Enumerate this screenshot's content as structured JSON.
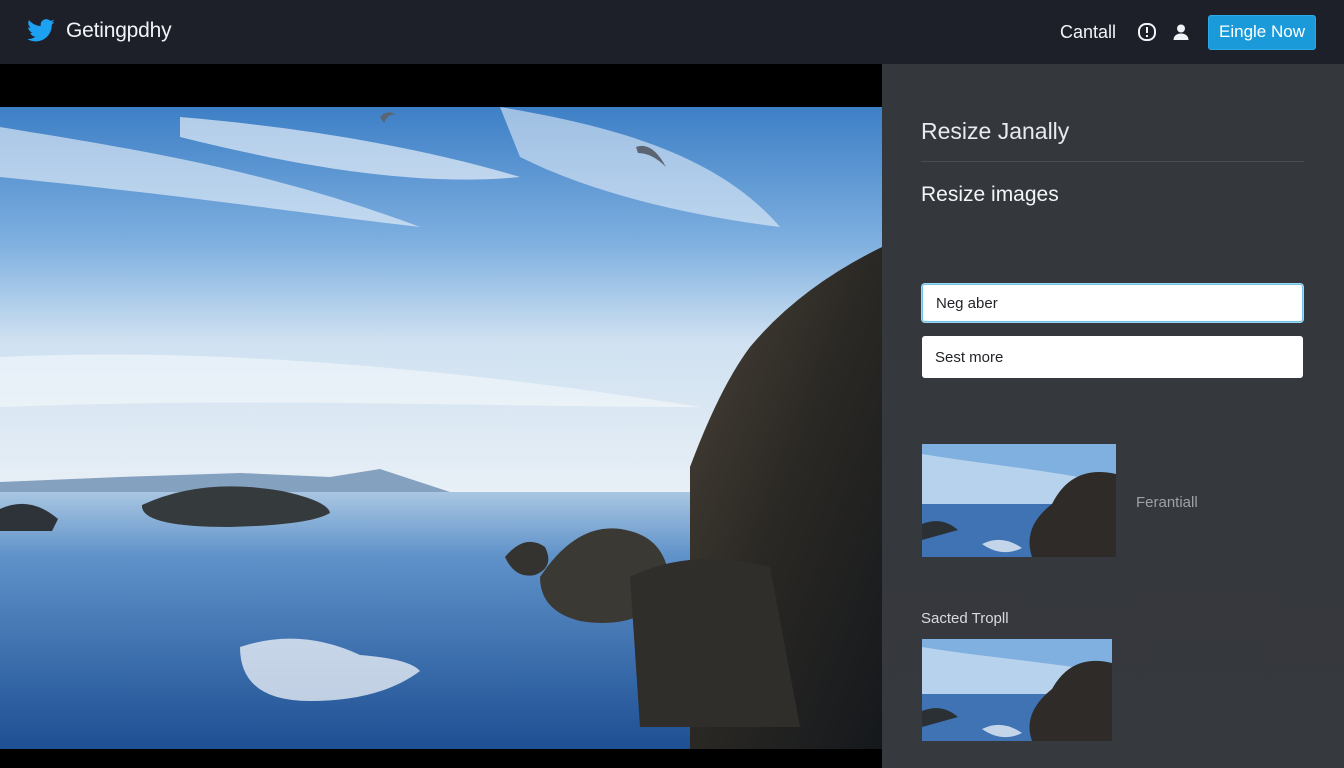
{
  "header": {
    "logo_icon": "bird-logo-icon",
    "app_title": "Getingpdhy",
    "link_label": "Cantall",
    "info_icon": "info-icon",
    "user_icon": "user-icon",
    "cta_label": "Eingle Now",
    "accent": "#1a9ad8"
  },
  "main": {
    "image": "coastal-rocks-seascape"
  },
  "panel": {
    "title": "Resize Janally",
    "subtitle": "Resize images",
    "field1_value": "Neg aber",
    "field2_value": "Sest more",
    "thumb_label": "Ferantiall",
    "section_label": "Sacted Tropll"
  }
}
